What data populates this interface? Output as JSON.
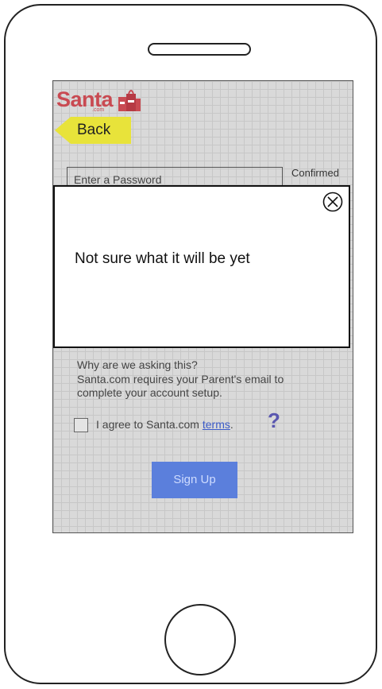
{
  "logo": {
    "text": "Santa",
    "sub": ".com"
  },
  "nav": {
    "back_label": "Back"
  },
  "form": {
    "password_placeholder": "Enter a Password",
    "confirmed_label": "Confirmed"
  },
  "info": {
    "title": "Why are we asking this?",
    "body": "Santa.com requires your Parent's email to complete your account setup."
  },
  "agree": {
    "prefix": "I agree to Santa.com ",
    "link": "terms",
    "suffix": "."
  },
  "help_icon": "?",
  "signup_label": "Sign Up",
  "modal": {
    "message": "Not sure what it will be yet",
    "close_icon": "close-circle-icon"
  },
  "colors": {
    "logo": "#c94a52",
    "back": "#e8e33a",
    "signup": "#5b7fdc",
    "link": "#3b5bc9"
  }
}
